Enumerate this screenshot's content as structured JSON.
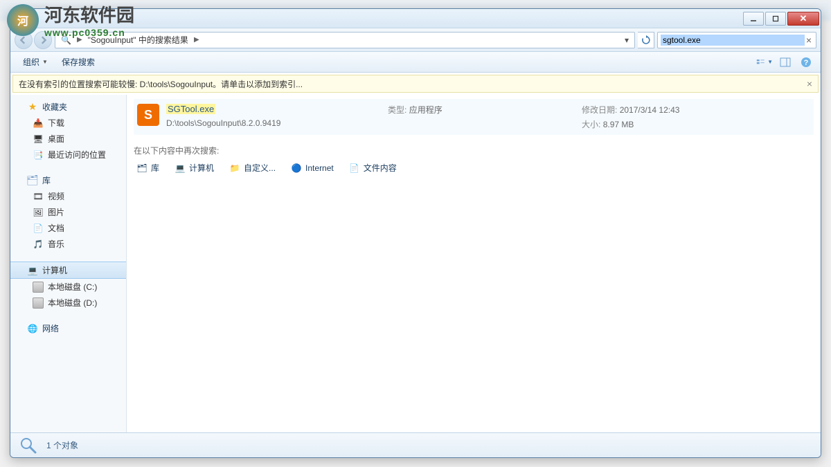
{
  "watermark": {
    "cn": "河东软件园",
    "url": "www.pc0359.cn"
  },
  "window": {
    "breadcrumb": {
      "seg1": "\"SogouInput\"",
      "seg2": "中的搜索结果"
    },
    "search_value": "sgtool.exe"
  },
  "toolbar": {
    "organize": "组织",
    "save_search": "保存搜索"
  },
  "infobar": {
    "text": "在没有索引的位置搜索可能较慢: D:\\tools\\SogouInput。请单击以添加到索引..."
  },
  "sidebar": {
    "favorites": {
      "label": "收藏夹",
      "items": [
        "下载",
        "桌面",
        "最近访问的位置"
      ]
    },
    "libraries": {
      "label": "库",
      "items": [
        "视频",
        "图片",
        "文档",
        "音乐"
      ]
    },
    "computer": {
      "label": "计算机",
      "items": [
        "本地磁盘 (C:)",
        "本地磁盘 (D:)"
      ]
    },
    "network": {
      "label": "网络"
    }
  },
  "result": {
    "name": "SGTool.exe",
    "path": "D:\\tools\\SogouInput\\8.2.0.9419",
    "type_label": "类型:",
    "type_value": "应用程序",
    "date_label": "修改日期:",
    "date_value": "2017/3/14 12:43",
    "size_label": "大小:",
    "size_value": "8.97 MB"
  },
  "search_again": {
    "label": "在以下内容中再次搜索:",
    "targets": [
      "库",
      "计算机",
      "自定义...",
      "Internet",
      "文件内容"
    ]
  },
  "status": {
    "text": "1 个对象"
  }
}
